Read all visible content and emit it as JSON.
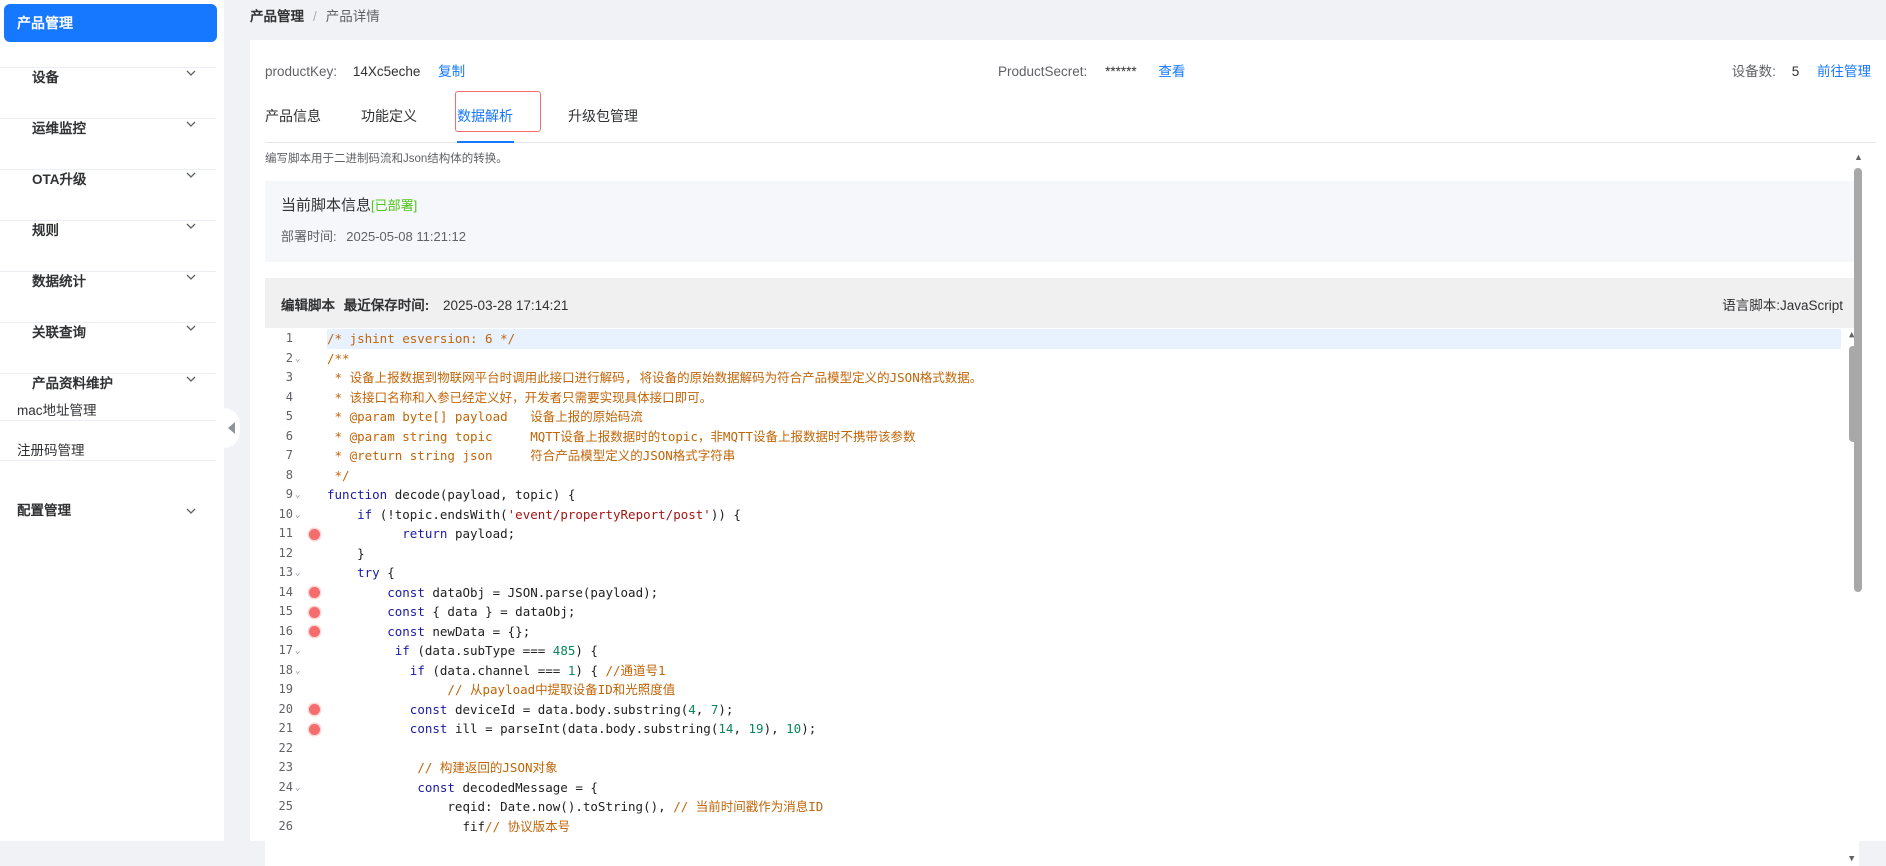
{
  "sidebar": {
    "active": "产品管理",
    "items": [
      {
        "label": "设备"
      },
      {
        "label": "运维监控"
      },
      {
        "label": "OTA升级"
      },
      {
        "label": "规则"
      },
      {
        "label": "数据统计"
      },
      {
        "label": "关联查询"
      },
      {
        "label": "产品资料维护"
      }
    ],
    "sub_items": [
      {
        "label": "mac地址管理"
      },
      {
        "label": "注册码管理"
      }
    ],
    "last_item": {
      "label": "配置管理"
    }
  },
  "breadcrumb": {
    "root": "产品管理",
    "sep": "/",
    "current": "产品详情"
  },
  "product": {
    "key_label": "productKey:",
    "key_value": "14Xc5eche",
    "copy_label": "复制",
    "secret_label": "ProductSecret:",
    "secret_value": "******",
    "view_label": "查看",
    "devices_label": "设备数:",
    "devices_value": "5",
    "goto_label": "前往管理"
  },
  "tabs": [
    {
      "label": "产品信息"
    },
    {
      "label": "功能定义"
    },
    {
      "label": "数据解析"
    },
    {
      "label": "升级包管理"
    }
  ],
  "description": "编写脚本用于二进制码流和Json结构体的转换。",
  "current_script": {
    "title": "当前脚本信息",
    "status": "[已部署]",
    "time_label": "部署时间:",
    "time_value": "2025-05-08 11:21:12"
  },
  "editor_header": {
    "title": "编辑脚本",
    "saved_label": "最近保存时间:",
    "saved_value": "2025-03-28 17:14:21",
    "lang_label": "语言脚本:",
    "lang_value": "JavaScript"
  },
  "code": {
    "lines": [
      {
        "n": "1",
        "text": "/* jshint esversion: 6 */",
        "fold": false,
        "bp": false
      },
      {
        "n": "2",
        "text": "/**",
        "fold": true,
        "bp": false
      },
      {
        "n": "3",
        "text": " * 设备上报数据到物联网平台时调用此接口进行解码, 将设备的原始数据解码为符合产品模型定义的JSON格式数据。",
        "fold": false,
        "bp": false
      },
      {
        "n": "4",
        "text": " * 该接口名称和入参已经定义好，开发者只需要实现具体接口即可。",
        "fold": false,
        "bp": false
      },
      {
        "n": "5",
        "text": " * @param byte[] payload   设备上报的原始码流",
        "fold": false,
        "bp": false
      },
      {
        "n": "6",
        "text": " * @param string topic     MQTT设备上报数据时的topic，非MQTT设备上报数据时不携带该参数",
        "fold": false,
        "bp": false
      },
      {
        "n": "7",
        "text": " * @return string json     符合产品模型定义的JSON格式字符串",
        "fold": false,
        "bp": false
      },
      {
        "n": "8",
        "text": " */",
        "fold": false,
        "bp": false
      },
      {
        "n": "9",
        "text": "function decode(payload, topic) {",
        "fold": true,
        "bp": false
      },
      {
        "n": "10",
        "text": "    if (!topic.endsWith('event/propertyReport/post')) {",
        "fold": true,
        "bp": false
      },
      {
        "n": "11",
        "text": "          return payload;",
        "fold": false,
        "bp": true
      },
      {
        "n": "12",
        "text": "    }",
        "fold": false,
        "bp": false
      },
      {
        "n": "13",
        "text": "    try {",
        "fold": true,
        "bp": false
      },
      {
        "n": "14",
        "text": "        const dataObj = JSON.parse(payload);",
        "fold": false,
        "bp": true
      },
      {
        "n": "15",
        "text": "        const { data } = dataObj;",
        "fold": false,
        "bp": true
      },
      {
        "n": "16",
        "text": "        const newData = {};",
        "fold": false,
        "bp": true
      },
      {
        "n": "17",
        "text": "         if (data.subType === 485) {",
        "fold": true,
        "bp": false
      },
      {
        "n": "18",
        "text": "           if (data.channel === 1) { //通道号1",
        "fold": true,
        "bp": false
      },
      {
        "n": "19",
        "text": "                // 从payload中提取设备ID和光照度值",
        "fold": false,
        "bp": false
      },
      {
        "n": "20",
        "text": "           const deviceId = data.body.substring(4, 7);",
        "fold": false,
        "bp": true
      },
      {
        "n": "21",
        "text": "           const ill = parseInt(data.body.substring(14, 19), 10);",
        "fold": false,
        "bp": true
      },
      {
        "n": "22",
        "text": "",
        "fold": false,
        "bp": false
      },
      {
        "n": "23",
        "text": "            // 构建返回的JSON对象",
        "fold": false,
        "bp": false
      },
      {
        "n": "24",
        "text": "            const decodedMessage = {",
        "fold": true,
        "bp": false
      },
      {
        "n": "25",
        "text": "                reqid: Date.now().toString(), // 当前时间戳作为消息ID",
        "fold": false,
        "bp": false
      },
      {
        "n": "26",
        "text": "                  fif// 协议版本号",
        "fold": false,
        "bp": false
      }
    ]
  },
  "colors": {
    "primary": "#1677ff",
    "deployed": "#52c41a",
    "breakpoint": "#f56c6c",
    "comment": "#c06508"
  }
}
